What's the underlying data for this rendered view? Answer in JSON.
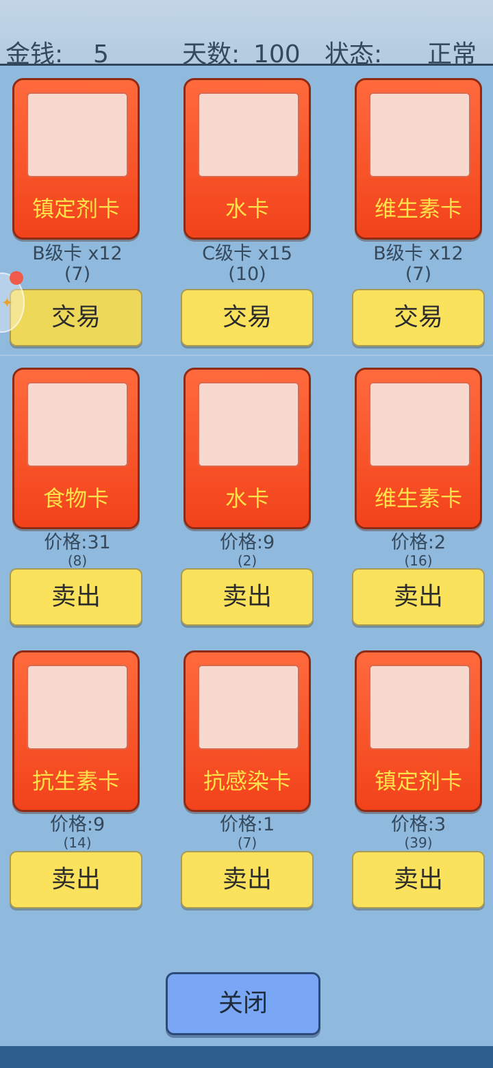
{
  "status": {
    "money_label": "金钱:",
    "money_value": "5",
    "days_label": "天数:",
    "days_value": "100",
    "state_label": "状态:",
    "state_value": "正常"
  },
  "trade_cards": [
    {
      "name": "镇定剂卡",
      "line1": "B级卡 x12",
      "line2": "(7)",
      "button": "交易"
    },
    {
      "name": "水卡",
      "line1": "C级卡 x15",
      "line2": "(10)",
      "button": "交易"
    },
    {
      "name": "维生素卡",
      "line1": "B级卡 x12",
      "line2": "(7)",
      "button": "交易"
    }
  ],
  "sell_cards": [
    {
      "name": "食物卡",
      "line1": "价格:31",
      "line2": "(8)",
      "button": "卖出"
    },
    {
      "name": "水卡",
      "line1": "价格:9",
      "line2": "(2)",
      "button": "卖出"
    },
    {
      "name": "维生素卡",
      "line1": "价格:2",
      "line2": "(16)",
      "button": "卖出"
    },
    {
      "name": "抗生素卡",
      "line1": "价格:9",
      "line2": "(14)",
      "button": "卖出"
    },
    {
      "name": "抗感染卡",
      "line1": "价格:1",
      "line2": "(7)",
      "button": "卖出"
    },
    {
      "name": "镇定剂卡",
      "line1": "价格:3",
      "line2": "(39)",
      "button": "卖出"
    }
  ],
  "close_label": "关闭",
  "colors": {
    "card": "#f2421b",
    "card_text": "#ffe14a",
    "button": "#fbe25c",
    "close_button": "#79a7f5"
  }
}
